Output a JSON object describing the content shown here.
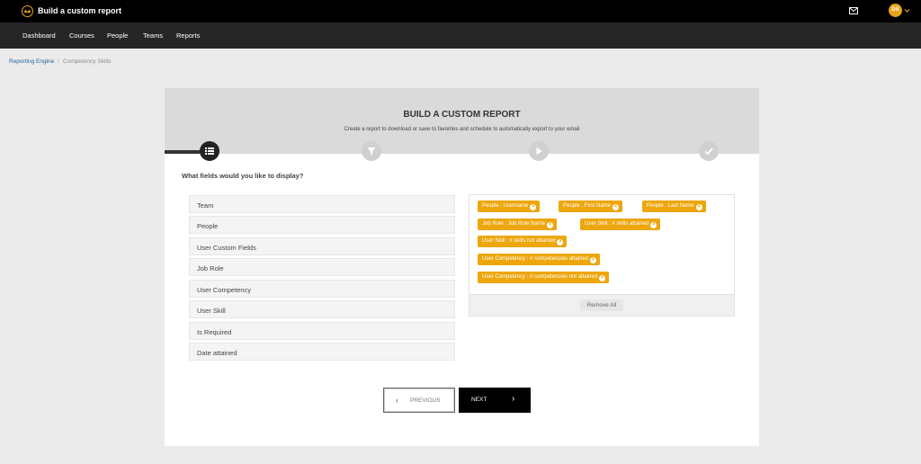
{
  "header": {
    "app_title": "Build a custom report",
    "avatar_initials": "DS"
  },
  "nav": {
    "items": [
      "Dashboard",
      "Courses",
      "People",
      "Teams",
      "Reports"
    ]
  },
  "breadcrumb": {
    "parent": "Reporting Engine",
    "separator": "/",
    "current": "Competency Skills"
  },
  "wizard": {
    "title": "BUILD A CUSTOM REPORT",
    "subtitle": "Create a report to download or save to favorites and schedule to automatically export to your email",
    "steps": [
      "list-icon",
      "filter-icon",
      "play-icon",
      "check-icon"
    ],
    "current_step": 1
  },
  "fields_section": {
    "question": "What fields would you like to display?",
    "available": [
      "Team",
      "People",
      "User Custom Fields",
      "Job Role",
      "User Competency",
      "User Skill",
      "Is Required",
      "Date attained"
    ],
    "selected": [
      "People : Username",
      "People : First Name",
      "People : Last Name",
      "Job Role : Job Role Name",
      "User Skill : # skills attained",
      "User Skill : # skills not attained",
      "User Competency : # competencies attained",
      "User Competency : # competencies not attained"
    ],
    "remove_all_label": "Remove All"
  },
  "buttons": {
    "previous": "PREVIOUS",
    "next": "NEXT"
  },
  "colors": {
    "accent": "#eda60c",
    "topbar": "#000000",
    "navbar": "#262626"
  }
}
